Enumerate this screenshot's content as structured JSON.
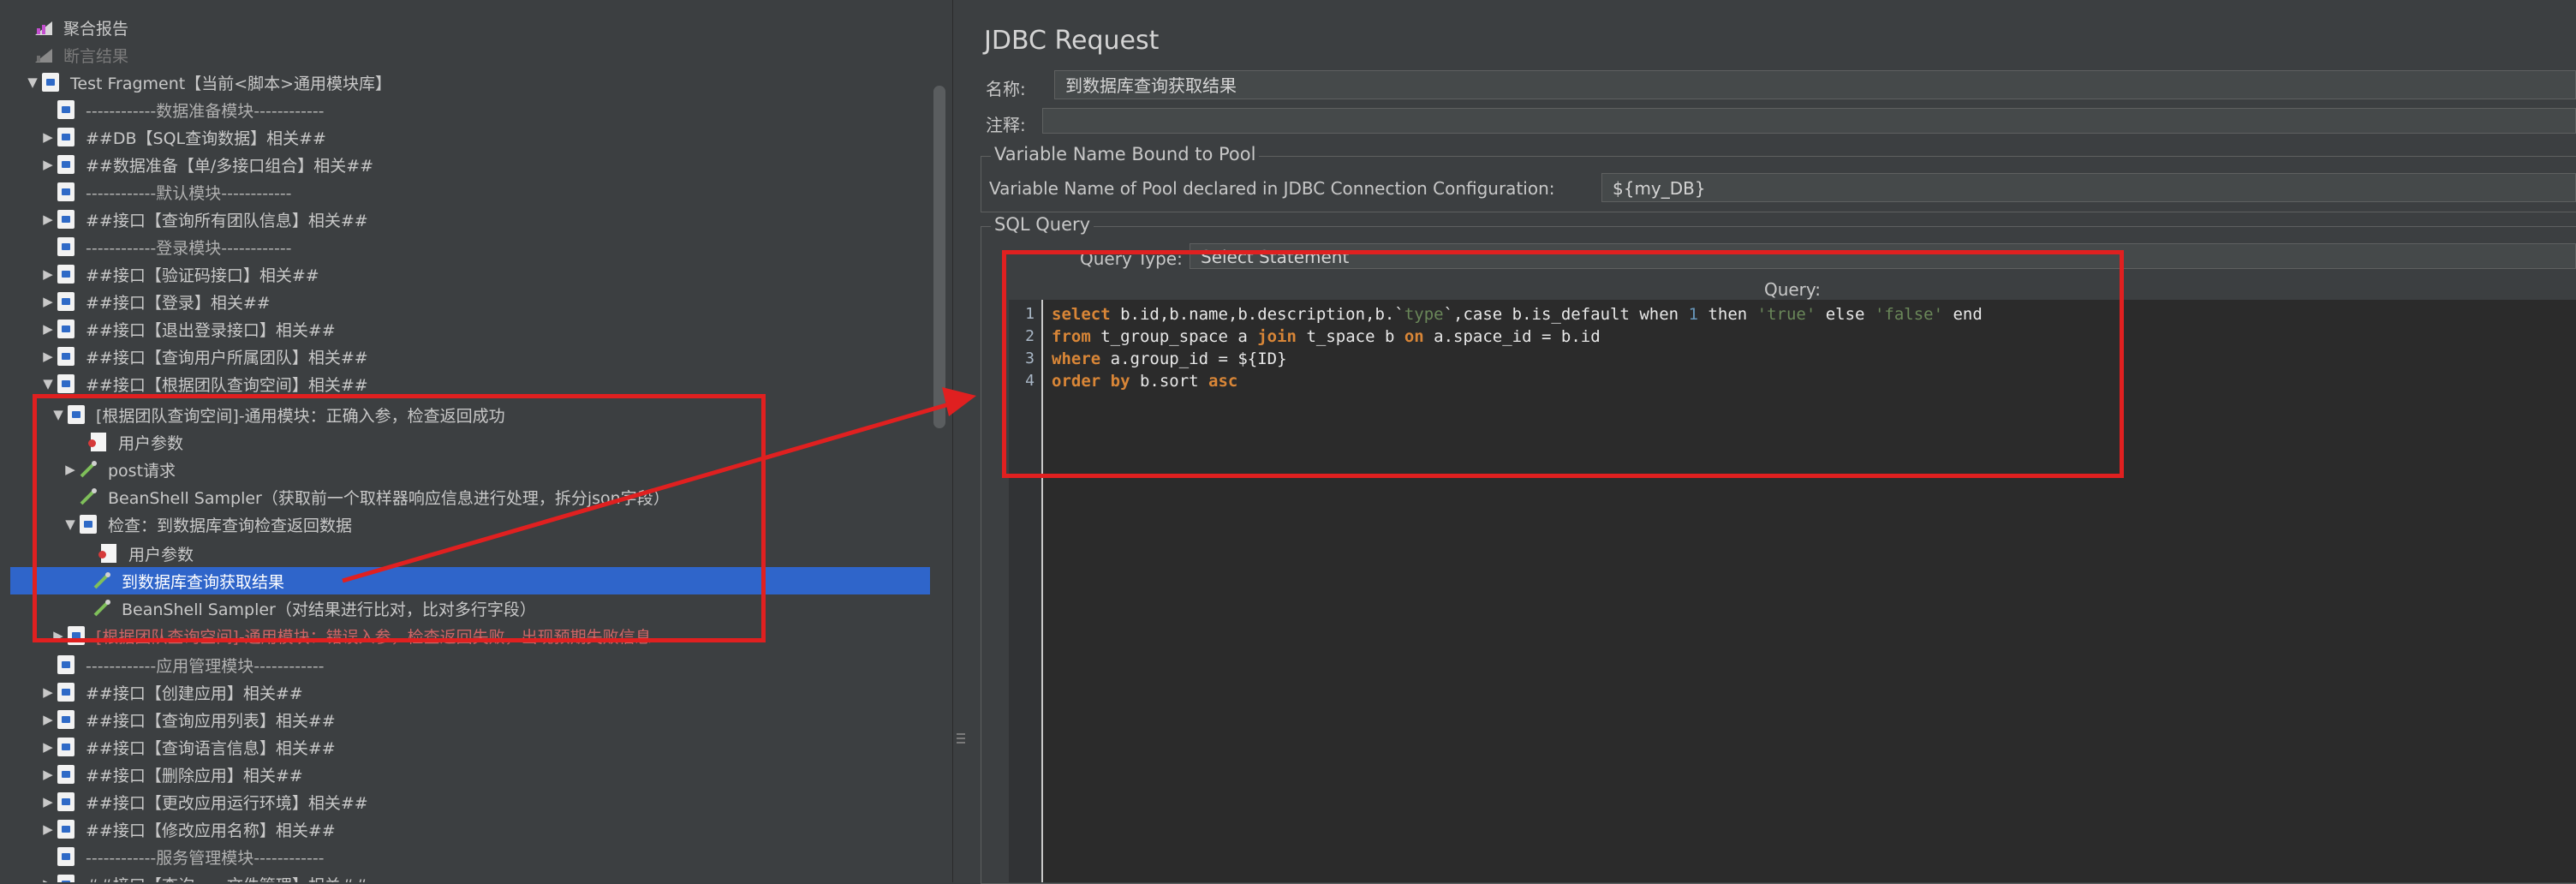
{
  "tree": {
    "items": [
      {
        "label": "聚合报告"
      },
      {
        "label": "断言结果"
      },
      {
        "label": "Test Fragment【当前<脚本>通用模块库】"
      },
      {
        "label": "------------数据准备模块------------"
      },
      {
        "label": "##DB【SQL查询数据】相关##"
      },
      {
        "label": "##数据准备【单/多接口组合】相关##"
      },
      {
        "label": "------------默认模块------------"
      },
      {
        "label": "##接口【查询所有团队信息】相关##"
      },
      {
        "label": "------------登录模块------------"
      },
      {
        "label": "##接口【验证码接口】相关##"
      },
      {
        "label": "##接口【登录】相关##"
      },
      {
        "label": "##接口【退出登录接口】相关##"
      },
      {
        "label": "##接口【查询用户所属团队】相关##"
      },
      {
        "label": "##接口【根据团队查询空间】相关##"
      },
      {
        "label": "[根据团队查询空间]-通用模块：正确入参，检查返回成功"
      },
      {
        "label": "用户参数"
      },
      {
        "label": "post请求"
      },
      {
        "label": "BeanShell Sampler（获取前一个取样器响应信息进行处理，拆分json字段）"
      },
      {
        "label": "检查：到数据库查询检查返回数据"
      },
      {
        "label": "用户参数"
      },
      {
        "label": "到数据库查询获取结果"
      },
      {
        "label": "BeanShell Sampler（对结果进行比对，比对多行字段）"
      },
      {
        "label": "[根据团队查询空间]-通用模块：错误入参，检查返回失败，出现预期失败信息"
      },
      {
        "label": "------------应用管理模块------------"
      },
      {
        "label": "##接口【创建应用】相关##"
      },
      {
        "label": "##接口【查询应用列表】相关##"
      },
      {
        "label": "##接口【查询语言信息】相关##"
      },
      {
        "label": "##接口【删除应用】相关##"
      },
      {
        "label": "##接口【更改应用运行环境】相关##"
      },
      {
        "label": "##接口【修改应用名称】相关##"
      },
      {
        "label": "------------服务管理模块------------"
      },
      {
        "label": "##接口【查询……文件管理】相关##"
      }
    ]
  },
  "panel": {
    "title": "JDBC Request",
    "name_label": "名称:",
    "name_value": "到数据库查询获取结果",
    "comment_label": "注释:",
    "comment_value": "",
    "pool_group_title": "Variable Name Bound to Pool",
    "pool_label": "Variable Name of Pool declared in JDBC Connection Configuration:",
    "pool_value": "${my_DB}",
    "sql_group_title": "SQL Query",
    "query_type_label": "Query Type:",
    "query_type_value": "Select Statement",
    "query_header": "Query:"
  },
  "editor": {
    "line_numbers": [
      "1",
      "2",
      "3",
      "4"
    ]
  },
  "colors": {
    "selection": "#2f65ca",
    "annotation": "#e02020",
    "keyword": "#d98637",
    "string": "#6a8759"
  }
}
